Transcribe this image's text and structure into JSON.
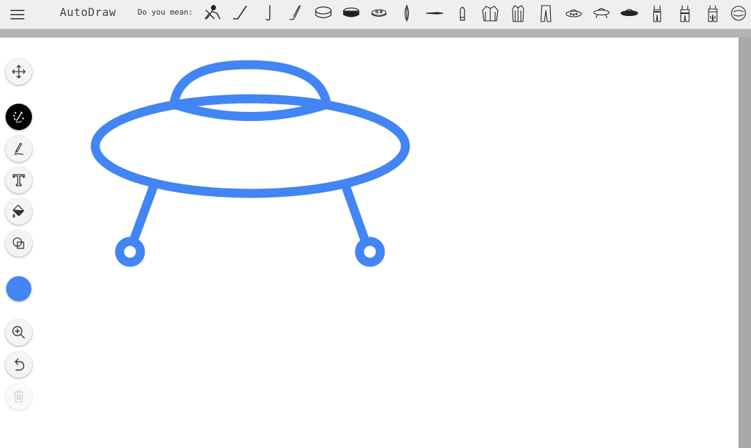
{
  "app": {
    "title": "AutoDraw"
  },
  "toolbar": {
    "menu_icon": "hamburger-menu-icon",
    "suggestions_label": "Do you mean:",
    "suggestions": [
      "hockey-player-icon",
      "hockey-stick-icon",
      "golf-club-icon",
      "hockey-stick-icon",
      "hockey-puck-outline-icon",
      "hockey-puck-icon",
      "sushi-icon",
      "surfboard-icon",
      "knife-icon",
      "bullet-icon",
      "jacket-icon",
      "overcoat-icon",
      "trousers-icon",
      "flying-saucer-icon",
      "flying-saucer-icon",
      "flying-saucer-icon",
      "overalls-icon",
      "overalls-icon",
      "overalls-icon",
      "round-badge-icon"
    ]
  },
  "sidebar": {
    "tools": [
      {
        "name": "move-tool",
        "icon": "move-arrows-icon",
        "active": false
      },
      {
        "name": "autodraw-tool",
        "icon": "magic-pen-icon",
        "active": true
      },
      {
        "name": "draw-tool",
        "icon": "pencil-icon",
        "active": false
      },
      {
        "name": "type-tool",
        "icon": "text-t-icon",
        "active": false
      },
      {
        "name": "fill-tool",
        "icon": "paint-bucket-icon",
        "active": false
      },
      {
        "name": "shape-tool",
        "icon": "shapes-icon",
        "active": false
      },
      {
        "name": "zoom-tool",
        "icon": "zoom-in-icon",
        "active": false
      },
      {
        "name": "undo-tool",
        "icon": "undo-icon",
        "active": false
      },
      {
        "name": "delete-tool",
        "icon": "trash-icon",
        "active": false,
        "disabled": true
      }
    ],
    "current_color": "#4285f4"
  },
  "canvas": {
    "drawing_label": "ufo-drawing",
    "stroke_color": "#4285f4",
    "background": "#ffffff"
  }
}
